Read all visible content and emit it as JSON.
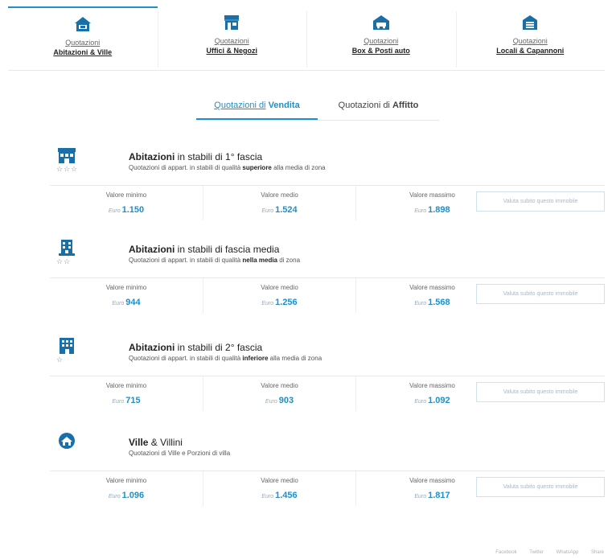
{
  "categories": [
    {
      "sub": "Quotazioni",
      "main": "Abitazioni & Ville",
      "icon": "house-icon",
      "active": true
    },
    {
      "sub": "Quotazioni",
      "main": "Uffici & Negozi",
      "icon": "shop-icon",
      "active": false
    },
    {
      "sub": "Quotazioni",
      "main": "Box & Posti auto",
      "icon": "car-garage-icon",
      "active": false
    },
    {
      "sub": "Quotazioni",
      "main": "Locali & Capannoni",
      "icon": "warehouse-icon",
      "active": false
    }
  ],
  "mode_tabs": [
    {
      "prefix": "Quotazioni di",
      "bold": "Vendita",
      "active": true
    },
    {
      "prefix": "Quotazioni di",
      "bold": "Affitto",
      "active": false
    }
  ],
  "labels": {
    "min": "Valore minimo",
    "avg": "Valore medio",
    "max": "Valore massimo",
    "currency": "Euro",
    "eval_button": "Valuta subito questo immobile"
  },
  "sections": [
    {
      "icon": "building-icon",
      "stars": "☆☆☆",
      "title_bold": "Abitazioni",
      "title_rest": " in stabili di 1° fascia",
      "desc_pre": "Quotazioni di appart. in stabili di qualità ",
      "desc_bold": "superiore",
      "desc_post": " alla media di zona",
      "min": "1.150",
      "avg": "1.524",
      "max": "1.898"
    },
    {
      "icon": "building-icon",
      "stars": "☆☆",
      "title_bold": "Abitazioni",
      "title_rest": " in stabili di fascia media",
      "desc_pre": "Quotazioni di appart. in stabili di qualità ",
      "desc_bold": "nella media",
      "desc_post": " di zona",
      "min": "944",
      "avg": "1.256",
      "max": "1.568"
    },
    {
      "icon": "apartment-icon",
      "stars": "☆",
      "title_bold": "Abitazioni",
      "title_rest": " in stabili di 2° fascia",
      "desc_pre": "Quotazioni di appart. in stabili di qualità ",
      "desc_bold": "inferiore",
      "desc_post": " alla media di zona",
      "min": "715",
      "avg": "903",
      "max": "1.092"
    },
    {
      "icon": "villa-icon",
      "stars": "",
      "title_bold": "Ville",
      "title_rest": " & Villini",
      "desc_pre": "Quotazioni di Ville e Porzioni di villa",
      "desc_bold": "",
      "desc_post": "",
      "min": "1.096",
      "avg": "1.456",
      "max": "1.817"
    }
  ],
  "footer": [
    "Facebook",
    "Twitter",
    "WhatsApp",
    "Share"
  ],
  "colors": {
    "accent": "#1f8fc9",
    "icon": "#1b6fa8"
  }
}
